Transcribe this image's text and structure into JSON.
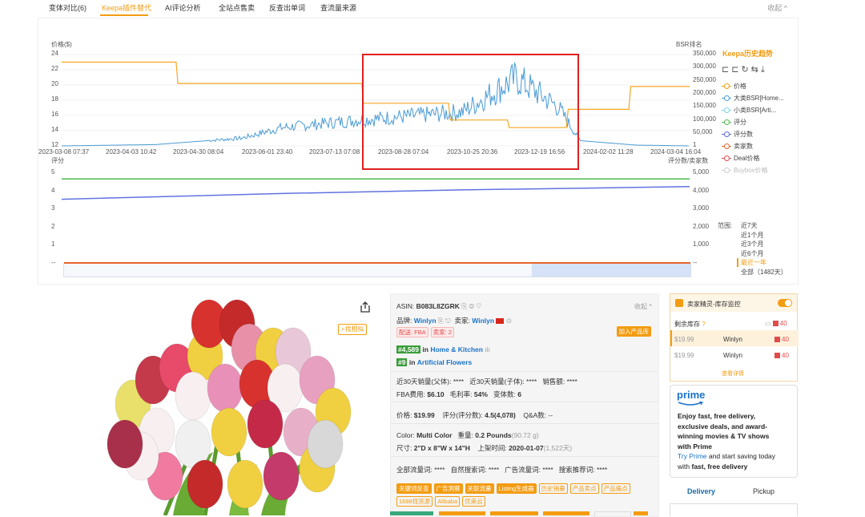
{
  "tabs": {
    "items": [
      {
        "label": "变体对比(6)"
      },
      {
        "label": "Keepa插件替代"
      },
      {
        "label": "AI评论分析"
      },
      {
        "label": "全站点售卖"
      },
      {
        "label": "反查出单词"
      },
      {
        "label": "查流量来源"
      }
    ],
    "active_index": 1,
    "collapse_label": "收起 ^"
  },
  "chart": {
    "price_axis_label": "价格($)",
    "price_ticks": [
      "24",
      "22",
      "20",
      "18",
      "16",
      "14",
      "12"
    ],
    "bsr_axis_label": "BSR排名",
    "bsr_ticks": [
      "350,000",
      "300,000",
      "250,000",
      "200,000",
      "150,000",
      "100,000",
      "50,000",
      "1"
    ],
    "date_ticks": [
      "2023-03-08 07:37",
      "2023-04-03 10:42",
      "2023-04-30 08:04",
      "2023-06-01 23:40",
      "2023-07-13 07:08",
      "2023-08-28 07:04",
      "2023-10-25 20:36",
      "2023-12-19 16:56",
      "2024-02-02 11:28",
      "2024-03-04 16:04"
    ],
    "rating_axis_label": "评分",
    "rating_ticks": [
      "5",
      "4",
      "3",
      "2",
      "1",
      "--"
    ],
    "review_axis_label": "评分数/卖家数",
    "review_ticks": [
      "5,000",
      "4,000",
      "3,000",
      "2,000",
      "1,000",
      "--"
    ],
    "legend_title": "Keepa历史趋势",
    "legend_items": [
      {
        "label": "价格",
        "color": "#f39c12"
      },
      {
        "label": "大类BSR[Home...",
        "color": "#4a9bd6"
      },
      {
        "label": "小类BSR[Arti...",
        "color": "#7fd3e8"
      },
      {
        "label": "评分",
        "color": "#4cb84c"
      },
      {
        "label": "评分数",
        "color": "#5a6ad6"
      },
      {
        "label": "卖家数",
        "color": "#e8642c"
      },
      {
        "label": "Deal价格",
        "color": "#e04b4b"
      },
      {
        "label": "Buybox价格",
        "color": "#cfcfcf"
      }
    ],
    "range_label": "范围:",
    "range_items": [
      "近7天",
      "近1个月",
      "近3个月",
      "近6个月",
      "最近一年",
      "全部（1482天）"
    ],
    "range_active_index": 4,
    "tool_icons": [
      "zoom-in-icon",
      "zoom-out-icon",
      "refresh-icon",
      "swap-icon",
      "download-icon"
    ]
  },
  "chart_data": {
    "type": "line",
    "x_range": [
      "2023-03-08",
      "2024-03-04"
    ],
    "series": [
      {
        "name": "价格",
        "points": [
          [
            "2023-03-08",
            23
          ],
          [
            "2023-05-13",
            23
          ],
          [
            "2023-05-14",
            20.2
          ],
          [
            "2023-08-28",
            20.2
          ],
          [
            "2023-08-29",
            17.6
          ],
          [
            "2023-10-17",
            17.6
          ],
          [
            "2023-10-18",
            15.4
          ],
          [
            "2023-11-20",
            15.4
          ],
          [
            "2023-11-21",
            14.4
          ],
          [
            "2023-12-24",
            14.4
          ],
          [
            "2023-12-25",
            16.8
          ],
          [
            "2024-01-29",
            16.8
          ],
          [
            "2024-01-30",
            19.8
          ],
          [
            "2024-03-04",
            19.8
          ]
        ]
      },
      {
        "name": "大类BSR[Home...",
        "points": [
          [
            "2023-03-08",
            1
          ],
          [
            "2023-05-01",
            5000
          ],
          [
            "2023-06-20",
            30000
          ],
          [
            "2023-07-13",
            70000
          ],
          [
            "2023-08-28",
            100000
          ],
          [
            "2023-10-25",
            130000
          ],
          [
            "2023-11-25",
            260000
          ],
          [
            "2023-12-19",
            150000
          ],
          [
            "2024-01-01",
            20000
          ],
          [
            "2024-02-02",
            3000
          ],
          [
            "2024-03-04",
            1
          ]
        ]
      },
      {
        "name": "评分",
        "points": [
          [
            "2023-03-08",
            4.5
          ],
          [
            "2024-03-04",
            4.5
          ]
        ]
      },
      {
        "name": "评分数",
        "points": [
          [
            "2023-03-08",
            3380
          ],
          [
            "2023-07-13",
            3700
          ],
          [
            "2023-10-25",
            3900
          ],
          [
            "2024-03-04",
            4078
          ]
        ]
      }
    ]
  },
  "product": {
    "asin_label": "ASIN:",
    "asin": "B083L8ZGRK",
    "collapse_label": "收起 ^",
    "brand_label": "品牌:",
    "brand": "Winlyn",
    "seller_label": "卖家:",
    "seller": "Winlyn",
    "fba_tag": "配送: FBA",
    "sellers_tag": "卖家: 2",
    "add_product_button": "加入产品库",
    "rank1": "#4,589",
    "rank1_in": "in",
    "rank1_cat": "Home & Kitchen",
    "rank2": "#9",
    "rank2_in": "in",
    "rank2_cat": "Artificial Flowers",
    "sales30_parent_label": "近30天销量(父体):",
    "sales30_parent": "****",
    "sales30_child_label": "近30天销量(子体):",
    "sales30_child": "****",
    "revenue_label": "销售额:",
    "revenue": "****",
    "fba_fee_label": "FBA费用:",
    "fba_fee": "$6.10",
    "margin_label": "毛利率:",
    "margin": "54%",
    "variants_label": "变体数:",
    "variants": "6",
    "price_label": "价格:",
    "price": "$19.99",
    "rating_label": "评分(评分数):",
    "rating": "4.5(4,078)",
    "qa_label": "Q&A数:",
    "qa": "--",
    "color_label": "Color:",
    "color": "Multi Color",
    "weight_label": "重量:",
    "weight": "0.2 Pounds",
    "weight_g": "(90.72 g)",
    "size_label": "尺寸:",
    "size": "2\"D x 8\"W x 14\"H",
    "launch_label": "上架时间:",
    "launch": "2020-01-07",
    "launch_days": "(1,522天)",
    "traffic_labels": [
      "全部流量词:",
      "自然搜索词:",
      "广告流量词:",
      "搜索推荐词:"
    ],
    "traffic_values": [
      "****",
      "****",
      "****",
      "****"
    ],
    "tags_row1": [
      "关键词反查",
      "广告洞察",
      "关联流量",
      "Listing生成器",
      "历史销量",
      "产品卖点",
      "产品痛点"
    ],
    "tags_row2": [
      "1688找货源",
      "Alibaba",
      "优美云"
    ],
    "find_similar": "找相似"
  },
  "seller_panel": {
    "title": "卖家精灵-库存监控",
    "stock_label": "剩余库存",
    "stock_count": "40",
    "rows": [
      {
        "price": "$19.99",
        "seller": "Winlyn",
        "count": "40"
      },
      {
        "price": "$19.99",
        "seller": "Winlyn",
        "count": "40"
      }
    ],
    "details_link": "查看详情"
  },
  "prime": {
    "logo": "prime",
    "line1": "Enjoy fast, free delivery,",
    "line2": "exclusive deals, and award-",
    "line3": "winning movies & TV shows",
    "line4": "with Prime",
    "line5a": "Try Prime",
    "line5b": " and start saving today",
    "line6a": "with ",
    "line6b": "fast, free delivery"
  },
  "delivery": {
    "tab1": "Delivery",
    "tab2": "Pickup"
  }
}
